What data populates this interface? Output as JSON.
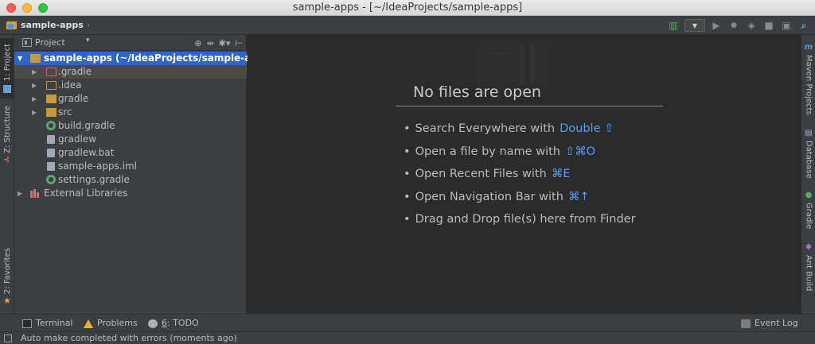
{
  "window": {
    "title": "sample-apps - [~/IdeaProjects/sample-apps]"
  },
  "navbar": {
    "breadcrumb": "sample-apps",
    "breadcrumb_sep": "›"
  },
  "toolbar": {
    "icons": [
      "make-icon",
      "run-config-dropdown",
      "run-icon",
      "debug-icon",
      "coverage-icon",
      "stop-icon",
      "sdk-icon",
      "search-icon"
    ],
    "run_config_caret": "▼"
  },
  "left_strip": {
    "tabs": [
      {
        "label": "1: Project",
        "icon": "project-icon",
        "active": true
      },
      {
        "label": "Z: Structure",
        "icon": "structure-icon",
        "active": false
      },
      {
        "label": "2: Favorites",
        "icon": "star-icon",
        "active": false
      }
    ]
  },
  "right_strip": {
    "tabs": [
      {
        "label": "Maven Projects",
        "icon": "maven-icon",
        "glyph": "m"
      },
      {
        "label": "Database",
        "icon": "database-icon",
        "glyph": "▤"
      },
      {
        "label": "Gradle",
        "icon": "gradle-icon",
        "glyph": "●"
      },
      {
        "label": "Ant Build",
        "icon": "ant-icon",
        "glyph": "✱"
      }
    ]
  },
  "project_panel": {
    "title": "Project",
    "caret": "▾",
    "tool_icons": [
      "⊕",
      "⇹",
      "✱▾",
      "⊢"
    ],
    "root": {
      "name": "sample-apps",
      "path": "(~/IdeaProjects/sample-apps)"
    },
    "items": [
      {
        "label": ".gradle",
        "kind": "folder-red",
        "expandable": true
      },
      {
        "label": ".idea",
        "kind": "folder-hollow",
        "expandable": true
      },
      {
        "label": "gradle",
        "kind": "folder",
        "expandable": true
      },
      {
        "label": "src",
        "kind": "folder",
        "expandable": true
      },
      {
        "label": "build.gradle",
        "kind": "gradle",
        "expandable": false
      },
      {
        "label": "gradlew",
        "kind": "file",
        "expandable": false
      },
      {
        "label": "gradlew.bat",
        "kind": "file",
        "expandable": false
      },
      {
        "label": "sample-apps.iml",
        "kind": "file",
        "expandable": false
      },
      {
        "label": "settings.gradle",
        "kind": "gradle",
        "expandable": false
      }
    ],
    "external": "External Libraries"
  },
  "editor": {
    "empty_title": "No files are open",
    "hints": [
      {
        "text": "Search Everywhere with",
        "key": "Double ⇧"
      },
      {
        "text": "Open a file by name with",
        "key": "⇧⌘O"
      },
      {
        "text": "Open Recent Files with",
        "key": "⌘E"
      },
      {
        "text": "Open Navigation Bar with",
        "key": "⌘↑"
      },
      {
        "text": "Drag and Drop file(s) here from Finder",
        "key": ""
      }
    ]
  },
  "bottom_tabs": {
    "terminal": "Terminal",
    "problems": "Problems",
    "todo_num": "6",
    "todo_rest": ": TODO",
    "event_log": "Event Log"
  },
  "status": {
    "message": "Auto make completed with errors (moments ago)"
  },
  "colors": {
    "accent": "#2f65ca",
    "link": "#589df6",
    "bg": "#2b2b2b",
    "panel": "#3c3f41"
  }
}
